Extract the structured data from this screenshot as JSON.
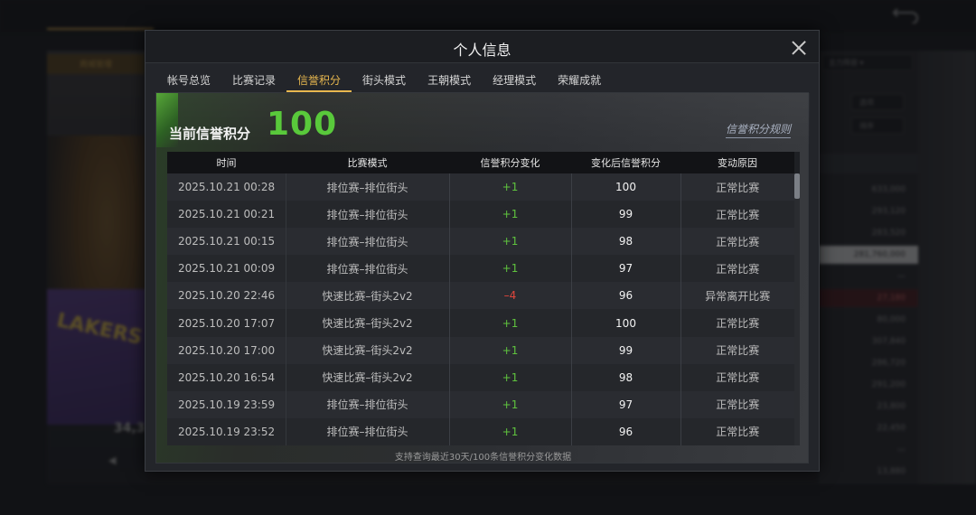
{
  "background": {
    "left_panel_header": "商城管理",
    "left_player_number": "34,3",
    "left_jersey_text": "LAKERS",
    "right_select": "主力阵容",
    "right_buttons": [
      "选项",
      "排序"
    ],
    "right_list_header": "",
    "right_list_values": [
      "633,000",
      "293,120",
      "283,520",
      "281,760,000",
      "—",
      "27,180",
      "80,000",
      "307,840",
      "286,720",
      "291,200",
      "23,800",
      "22,450",
      "—",
      "13,880"
    ]
  },
  "modal": {
    "title": "个人信息",
    "tabs": [
      {
        "label": "帐号总览",
        "active": false
      },
      {
        "label": "比赛记录",
        "active": false
      },
      {
        "label": "信誉积分",
        "active": true
      },
      {
        "label": "街头模式",
        "active": false
      },
      {
        "label": "王朝模式",
        "active": false
      },
      {
        "label": "经理模式",
        "active": false
      },
      {
        "label": "荣耀成就",
        "active": false
      }
    ],
    "score_label": "当前信誉积分",
    "score_value": "100",
    "rules_link": "信誉积分规则",
    "table": {
      "headers": [
        "时间",
        "比赛模式",
        "信誉积分变化",
        "变化后信誉积分",
        "变动原因"
      ],
      "rows": [
        {
          "time": "2025.10.21  00:28",
          "mode": "排位赛–排位街头",
          "delta": "+1",
          "after": "100",
          "reason": "正常比赛"
        },
        {
          "time": "2025.10.21  00:21",
          "mode": "排位赛–排位街头",
          "delta": "+1",
          "after": "99",
          "reason": "正常比赛"
        },
        {
          "time": "2025.10.21  00:15",
          "mode": "排位赛–排位街头",
          "delta": "+1",
          "after": "98",
          "reason": "正常比赛"
        },
        {
          "time": "2025.10.21  00:09",
          "mode": "排位赛–排位街头",
          "delta": "+1",
          "after": "97",
          "reason": "正常比赛"
        },
        {
          "time": "2025.10.20  22:46",
          "mode": "快速比赛–街头2v2",
          "delta": "–4",
          "after": "96",
          "reason": "异常离开比赛"
        },
        {
          "time": "2025.10.20  17:07",
          "mode": "快速比赛–街头2v2",
          "delta": "+1",
          "after": "100",
          "reason": "正常比赛"
        },
        {
          "time": "2025.10.20  17:00",
          "mode": "快速比赛–街头2v2",
          "delta": "+1",
          "after": "99",
          "reason": "正常比赛"
        },
        {
          "time": "2025.10.20  16:54",
          "mode": "快速比赛–街头2v2",
          "delta": "+1",
          "after": "98",
          "reason": "正常比赛"
        },
        {
          "time": "2025.10.19  23:59",
          "mode": "排位赛–排位街头",
          "delta": "+1",
          "after": "97",
          "reason": "正常比赛"
        },
        {
          "time": "2025.10.19  23:52",
          "mode": "排位赛–排位街头",
          "delta": "+1",
          "after": "96",
          "reason": "正常比赛"
        }
      ]
    },
    "footer_note": "支持查询最近30天/100条信誉积分变化数据"
  },
  "colors": {
    "accent": "#e8b84f",
    "score_green": "#59c93b",
    "positive": "#5fc33e",
    "negative": "#e0463c"
  }
}
